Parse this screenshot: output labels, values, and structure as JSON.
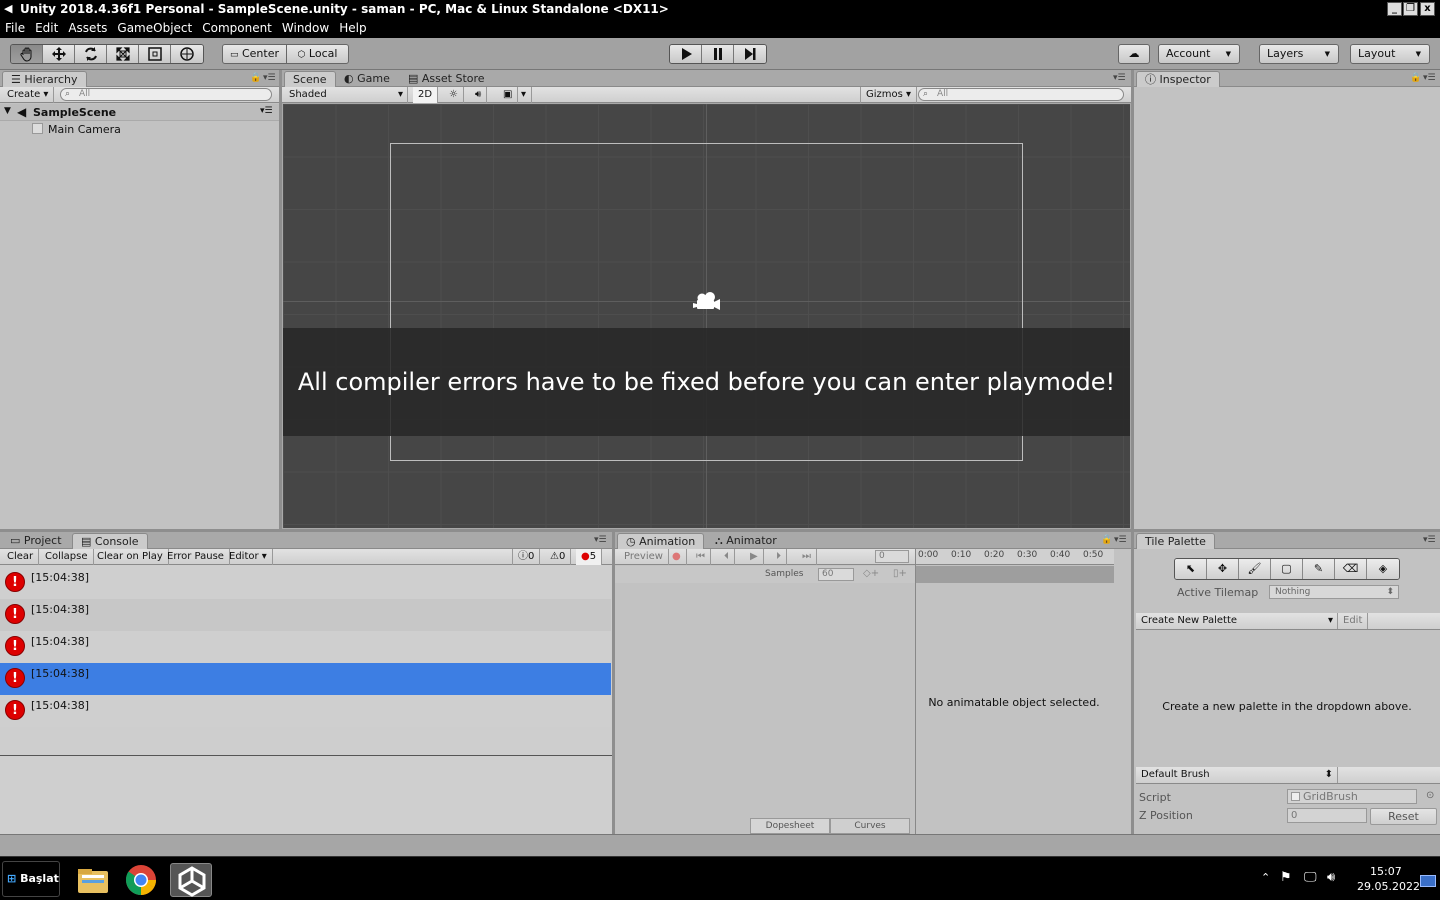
{
  "window": {
    "title": "Unity 2018.4.36f1 Personal - SampleScene.unity - saman - PC, Mac & Linux Standalone <DX11>",
    "controls": [
      "_",
      "❐",
      "x"
    ]
  },
  "menu": [
    "File",
    "Edit",
    "Assets",
    "GameObject",
    "Component",
    "Window",
    "Help"
  ],
  "toolbar": {
    "pivot_label": "Center",
    "space_label": "Local",
    "account_label": "Account",
    "layers_label": "Layers",
    "layout_label": "Layout"
  },
  "hierarchy": {
    "tab_label": "Hierarchy",
    "create_label": "Create",
    "search_placeholder": "All",
    "scene_name": "SampleScene",
    "items": [
      "Main Camera"
    ]
  },
  "scene": {
    "tabs": [
      "Scene",
      "Game",
      "Asset Store"
    ],
    "shading_mode": "Shaded",
    "mode_2d_label": "2D",
    "gizmos_label": "Gizmos",
    "search_placeholder": "All",
    "overlay_message": "All compiler errors have to be fixed before you can enter playmode!"
  },
  "inspector": {
    "tab_label": "Inspector"
  },
  "console": {
    "tabs": [
      "Project",
      "Console"
    ],
    "buttons": [
      "Clear",
      "Collapse",
      "Clear on Play",
      "Error Pause",
      "Editor"
    ],
    "counts": {
      "info": "0",
      "warnings": "0",
      "errors": "5"
    },
    "rows": [
      {
        "time": "[15:04:38]",
        "selected": false
      },
      {
        "time": "[15:04:38]",
        "selected": false
      },
      {
        "time": "[15:04:38]",
        "selected": false
      },
      {
        "time": "[15:04:38]",
        "selected": true
      },
      {
        "time": "[15:04:38]",
        "selected": false
      }
    ]
  },
  "animation": {
    "tabs": [
      "Animation",
      "Animator"
    ],
    "preview_label": "Preview",
    "frame_value": "0",
    "samples_label": "Samples",
    "samples_value": "60",
    "timeline_ticks": [
      "0:00",
      "0:10",
      "0:20",
      "0:30",
      "0:40",
      "0:50"
    ],
    "empty_message": "No animatable object selected.",
    "bottom_tabs": [
      "Dopesheet",
      "Curves"
    ]
  },
  "tile_palette": {
    "tab_label": "Tile Palette",
    "active_tilemap_label": "Active Tilemap",
    "active_tilemap_value": "Nothing",
    "palette_dropdown": "Create New Palette",
    "edit_label": "Edit",
    "empty_message": "Create a new palette in the dropdown above.",
    "brush_dropdown": "Default Brush",
    "script_label": "Script",
    "script_value": "GridBrush",
    "zpos_label": "Z Position",
    "zpos_value": "0",
    "reset_label": "Reset"
  },
  "taskbar": {
    "start_label": "Başlat",
    "time": "15:07",
    "date": "29.05.2022"
  }
}
